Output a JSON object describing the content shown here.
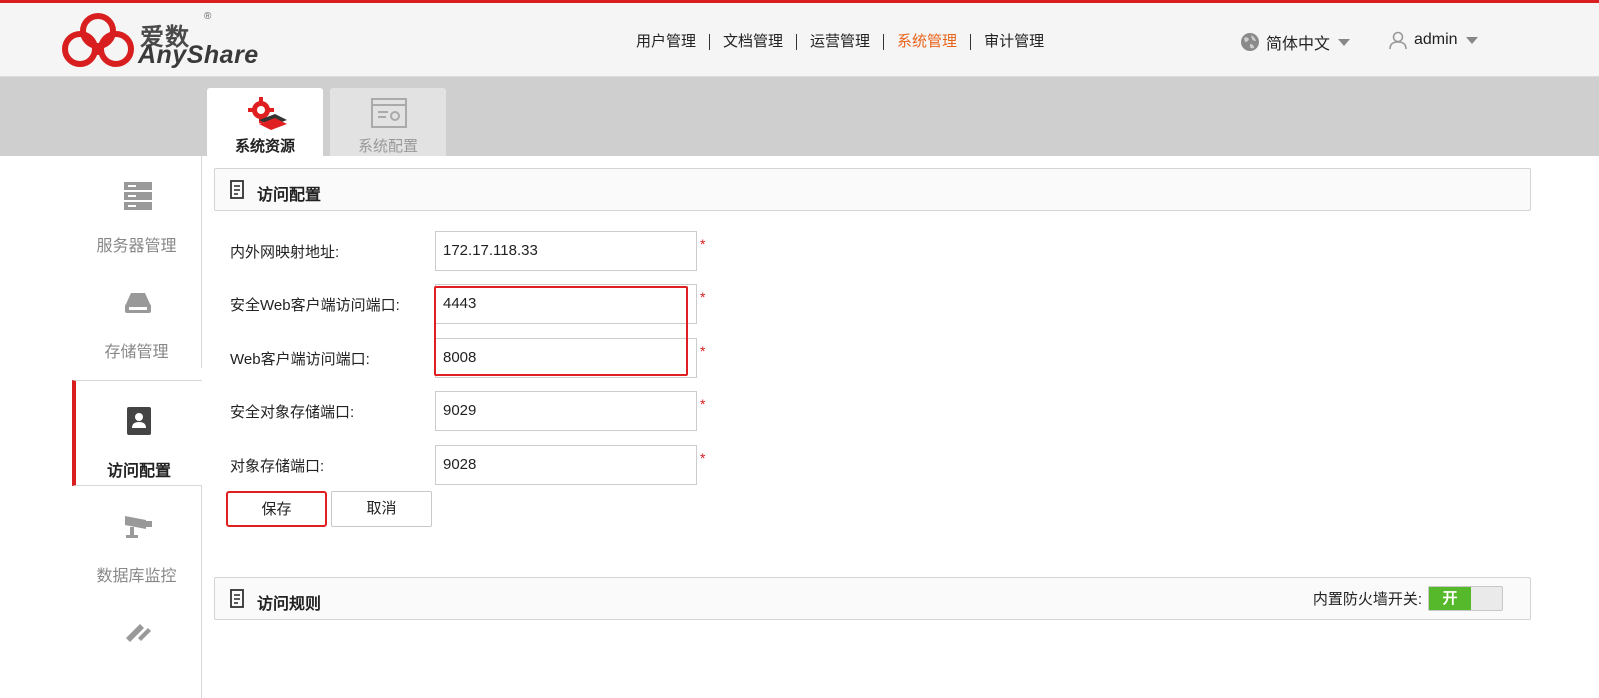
{
  "header": {
    "logo_cn": "爱数",
    "logo_reg": "®",
    "logo_en": "AnyShare",
    "nav": [
      {
        "label": "用户管理"
      },
      {
        "label": "文档管理"
      },
      {
        "label": "运营管理"
      },
      {
        "label": "系统管理",
        "active": true
      },
      {
        "label": "审计管理"
      }
    ],
    "language": "简体中文",
    "username": "admin"
  },
  "tabs": [
    {
      "label": "系统资源",
      "icon": "gear-server-icon",
      "active": true
    },
    {
      "label": "系统配置",
      "icon": "settings-window-icon",
      "active": false
    }
  ],
  "sidebar": [
    {
      "label": "服务器管理",
      "icon": "server-icon"
    },
    {
      "label": "存储管理",
      "icon": "storage-icon"
    },
    {
      "label": "访问配置",
      "icon": "contact-card-icon",
      "active": true
    },
    {
      "label": "数据库监控",
      "icon": "camera-icon"
    },
    {
      "label": "",
      "icon": "tools-icon"
    }
  ],
  "access_config": {
    "title": "访问配置",
    "fields": [
      {
        "label": "内外网映射地址:",
        "value": "172.17.118.33",
        "required": "*"
      },
      {
        "label": "安全Web客户端访问端口:",
        "value": "4443",
        "required": "*"
      },
      {
        "label": "Web客户端访问端口:",
        "value": "8008",
        "required": "*"
      },
      {
        "label": "安全对象存储端口:",
        "value": "9029",
        "required": "*"
      },
      {
        "label": "对象存储端口:",
        "value": "9028",
        "required": "*"
      }
    ],
    "save_label": "保存",
    "cancel_label": "取消"
  },
  "access_rules": {
    "title": "访问规则",
    "firewall_label": "内置防火墙开关:",
    "firewall_state": "开"
  },
  "colors": {
    "accent": "#e8641b",
    "brand_red": "#d81e1e",
    "toggle_on": "#55b92b"
  }
}
